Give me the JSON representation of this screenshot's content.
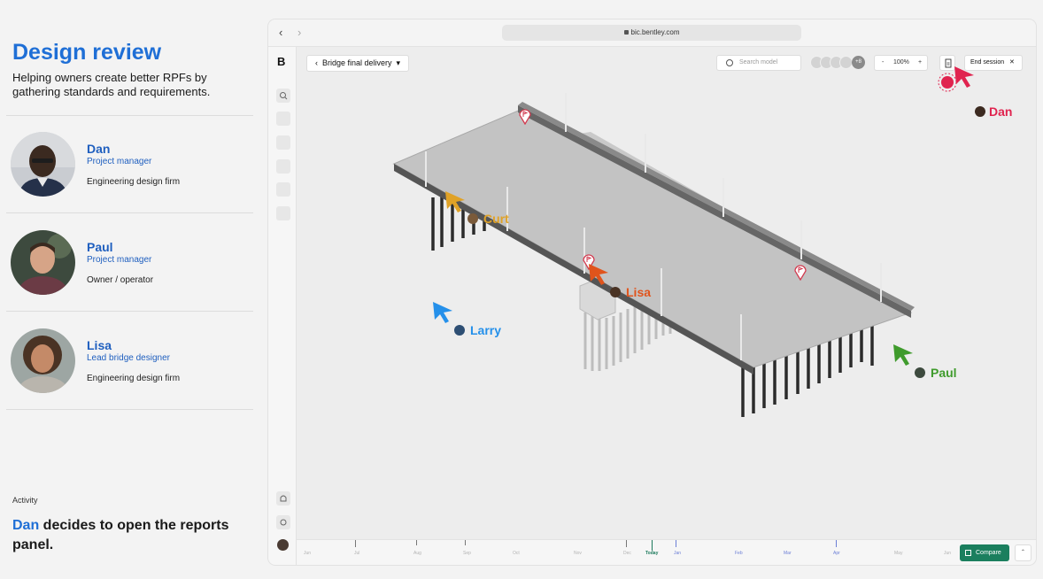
{
  "intro": {
    "title": "Design review",
    "subtitle": "Helping owners create better RPFs by gathering standards and requirements."
  },
  "people": [
    {
      "name": "Dan",
      "role": "Project manager",
      "org": "Engineering design firm"
    },
    {
      "name": "Paul",
      "role": "Project manager",
      "org": "Owner / operator"
    },
    {
      "name": "Lisa",
      "role": "Lead bridge designer",
      "org": "Engineering design firm"
    }
  ],
  "activity": {
    "label": "Activity",
    "actor": "Dan",
    "text": " decides to open the reports panel."
  },
  "browser": {
    "url": "bic.bentley.com",
    "back_icon": "chevron-left-icon",
    "forward_icon": "chevron-right-icon"
  },
  "app": {
    "logo": "B",
    "breadcrumb": "Bridge final delivery",
    "search_placeholder": "Search model",
    "participants_more": "+8",
    "zoom": {
      "minus": "-",
      "value": "100%",
      "plus": "+"
    },
    "end_session": "End session",
    "compare": "Compare"
  },
  "cursors": {
    "dan": {
      "name": "Dan",
      "color": "#e0244f"
    },
    "curt": {
      "name": "Curt",
      "color": "#e0a227"
    },
    "lisa": {
      "name": "Lisa",
      "color": "#e0541c"
    },
    "larry": {
      "name": "Larry",
      "color": "#2590ea"
    },
    "paul": {
      "name": "Paul",
      "color": "#3f9b2c"
    }
  },
  "timeline": {
    "labels": [
      "Jun",
      "Jul",
      "Aug",
      "Sep",
      "Oct",
      "Nov",
      "Dec",
      "Today",
      "Jan",
      "Feb",
      "Mar",
      "Apr",
      "May",
      "Jun"
    ]
  }
}
